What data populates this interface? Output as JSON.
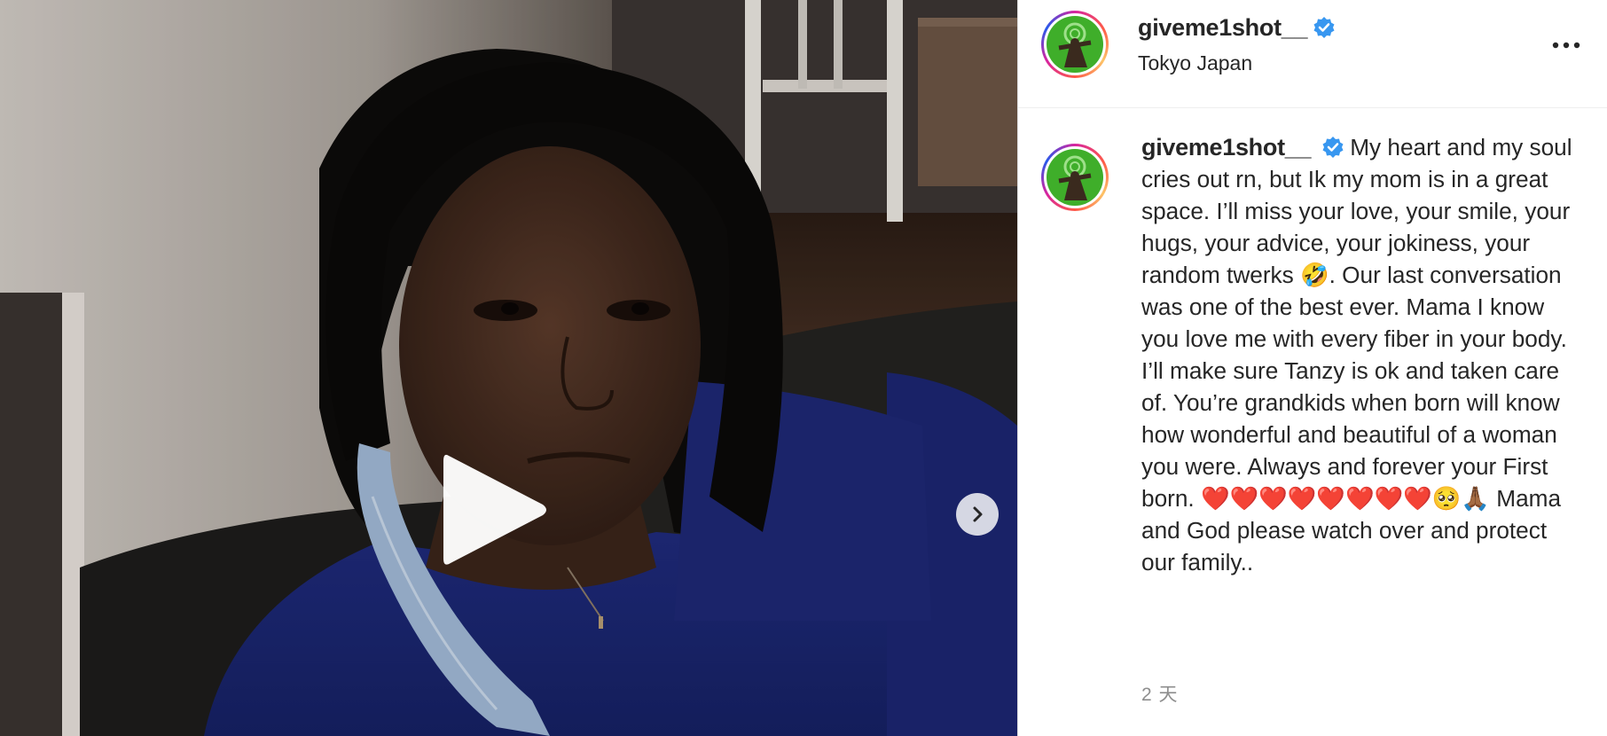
{
  "post": {
    "username": "giveme1shot__",
    "location": "Tokyo Japan",
    "caption": "My heart and my soul cries out rn, but Ik my mom is in a great space. I’ll miss your love, your smile, your hugs, your advice, your jokiness, your random twerks 🤣. Our last conversation was one of the best ever. Mama I know you love me with every fiber in your body. I’ll make sure Tanzy is ok and taken care of. You’re grandkids when born will know how wonderful and beautiful of a woman you were. Always and forever your First born. ❤️❤️❤️❤️❤️❤️❤️❤️🥺🙏🏾 Mama and God please watch over and protect our family..",
    "timestamp": "2 天"
  },
  "icons": {
    "verified": "verified-badge-icon",
    "more": "more-options-icon",
    "play": "play-icon",
    "next": "chevron-right-icon"
  },
  "colors": {
    "verified_blue": "#3897f0",
    "text": "#262626",
    "muted": "#8e8e8e",
    "avatar_green": "#3fae2a"
  }
}
